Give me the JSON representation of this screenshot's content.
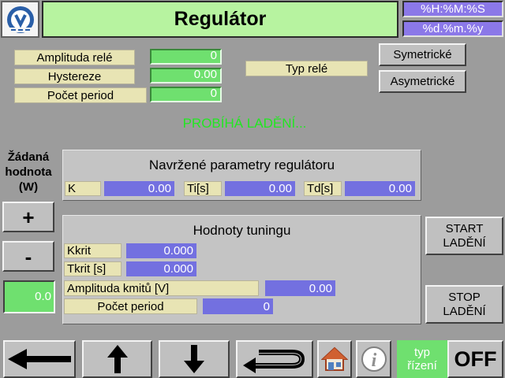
{
  "header": {
    "title": "Regulátor",
    "time_format": "%H:%M:%S",
    "date_format": "%d.%m.%y"
  },
  "relay": {
    "amplitude_label": "Amplituda relé",
    "amplitude_value": "0",
    "hysteresis_label": "Hystereze",
    "hysteresis_value": "0.00",
    "periods_label": "Počet period",
    "periods_value": "0",
    "type_label": "Typ relé",
    "symmetric_button": "Symetrické",
    "asymmetric_button": "Asymetrické"
  },
  "status": "PROBÍHÁ LADĚNÍ...",
  "setpoint": {
    "label": "Žádaná hodnota (W)",
    "plus": "+",
    "minus": "-",
    "value": "0.0"
  },
  "proposed": {
    "title": "Navržené parametry regulátoru",
    "k_label": "K",
    "k_value": "0.00",
    "ti_label": "Ti[s]",
    "ti_value": "0.00",
    "td_label": "Td[s]",
    "td_value": "0.00"
  },
  "tuning": {
    "title": "Hodnoty tuningu",
    "kkrit_label": "Kkrit",
    "kkrit_value": "0.000",
    "tkrit_label": "Tkrit [s]",
    "tkrit_value": "0.000",
    "amplitude_label": "Amplituda kmitů [V]",
    "amplitude_value": "0.00",
    "periods_label": "Počet period",
    "periods_value": "0"
  },
  "actions": {
    "start": "START LADĚNÍ",
    "stop": "STOP LADĚNÍ"
  },
  "toolbar": {
    "control_type_label": "typ řízení",
    "control_state": "OFF",
    "icons": [
      "arrow-left-icon",
      "arrow-up-icon",
      "arrow-down-icon",
      "return-icon",
      "home-icon",
      "info-icon"
    ]
  },
  "colors": {
    "background": "#9c9c9c",
    "title_green": "#b7f3a0",
    "value_blue": "#7370e0",
    "value_green": "#6fe06f",
    "status_green": "#23e623",
    "label_beige": "#e8e4b4"
  }
}
